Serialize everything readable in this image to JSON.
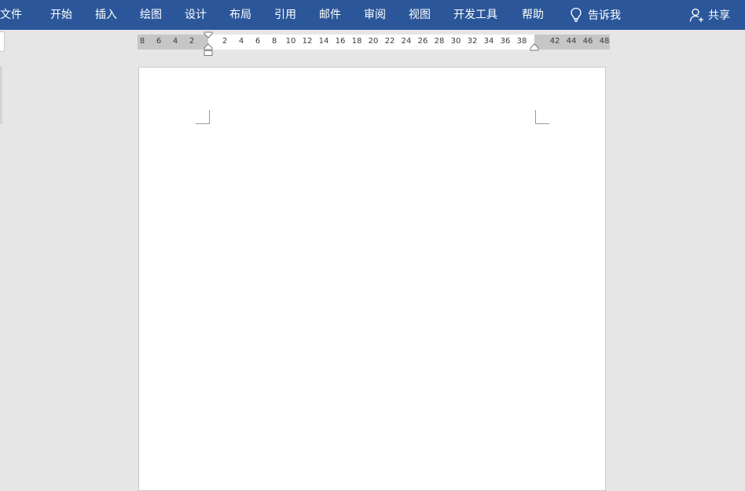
{
  "ribbon": {
    "tabs": [
      {
        "label": "文件"
      },
      {
        "label": "开始"
      },
      {
        "label": "插入"
      },
      {
        "label": "绘图"
      },
      {
        "label": "设计"
      },
      {
        "label": "布局"
      },
      {
        "label": "引用"
      },
      {
        "label": "邮件"
      },
      {
        "label": "审阅"
      },
      {
        "label": "视图"
      },
      {
        "label": "开发工具"
      },
      {
        "label": "帮助"
      }
    ],
    "tell_me": {
      "label": "告诉我",
      "icon": "lightbulb-icon"
    },
    "share": {
      "label": "共享",
      "icon": "person-add-icon"
    },
    "colors": {
      "ribbon_bg": "#2b579a",
      "text": "#ffffff"
    }
  },
  "ruler": {
    "left_numbers": [
      "8",
      "6",
      "4",
      "2"
    ],
    "right_numbers": [
      "2",
      "4",
      "6",
      "8",
      "10",
      "12",
      "14",
      "16",
      "18",
      "20",
      "22",
      "24",
      "26",
      "28",
      "30",
      "32",
      "34",
      "36",
      "38",
      "42",
      "44",
      "46",
      "48"
    ]
  }
}
